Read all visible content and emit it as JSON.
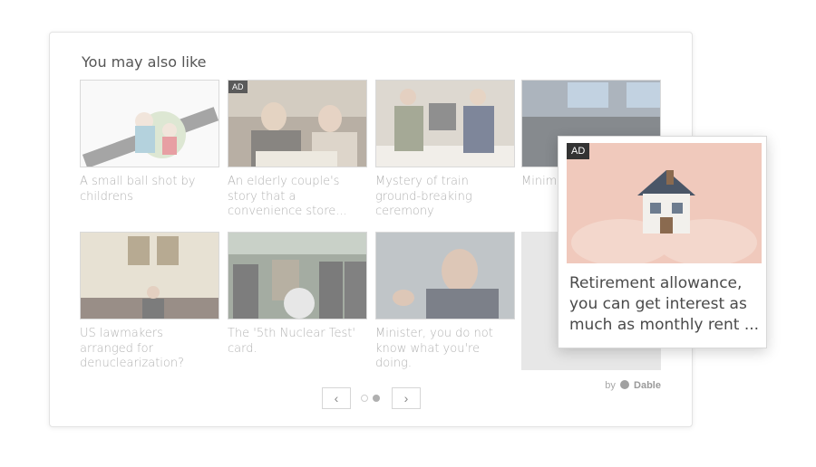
{
  "widget": {
    "title": "You may also like",
    "brand_prefix": "by",
    "brand_name": "Dable"
  },
  "cards": [
    {
      "title": "A small ball shot by childrens",
      "ad": false
    },
    {
      "title": "An elderly couple's story that a convenience store...",
      "ad": true,
      "ad_label": "AD"
    },
    {
      "title": "Mystery of train ground-breaking ceremony",
      "ad": false
    },
    {
      "title": "Minim... its dec...",
      "ad": false
    },
    {
      "title": "US lawmakers arranged for denuclearization?",
      "ad": false
    },
    {
      "title": "The '5th Nuclear Test' card.",
      "ad": false
    },
    {
      "title": "Minister, you do not know what you're doing.",
      "ad": false
    }
  ],
  "pager": {
    "prev_icon": "chevron-left-icon",
    "next_icon": "chevron-right-icon",
    "prev_glyph": "‹",
    "next_glyph": "›",
    "pages": 2,
    "active_page": 2
  },
  "popup": {
    "ad_label": "AD",
    "title": "Retirement allowance, you can get interest as much as monthly rent ..."
  },
  "colors": {
    "title_text": "#555555",
    "card_text": "#b3b3b3",
    "popup_text": "#4a4a4a",
    "ad_bg": "#333333"
  }
}
